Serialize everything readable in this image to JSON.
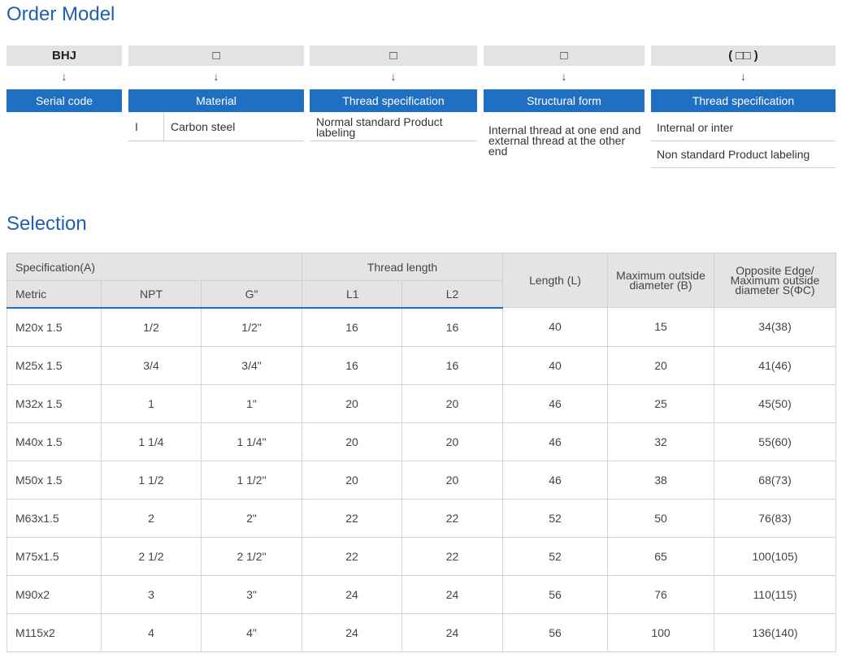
{
  "order": {
    "title": "Order Model",
    "codes": [
      "BHJ",
      "□",
      "□",
      "□",
      "( □□ )"
    ],
    "arrow": "↓",
    "labels": [
      "Serial code",
      "Material",
      "Thread specification",
      "Structural form",
      "Thread specification"
    ],
    "material": {
      "code": "I",
      "name": "Carbon steel"
    },
    "thread_spec": "Normal standard Product labeling",
    "structural": "Internal thread at one end and external thread at the other end",
    "thread_spec2": [
      "Internal or inter",
      "Non standard Product labeling"
    ]
  },
  "selection": {
    "title": "Selection",
    "headers": {
      "spec": "Specification(A)",
      "thread_length": "Thread length",
      "length": "Length (L)",
      "max_od": "Maximum outside diameter (B)",
      "opposite": "Opposite Edge/ Maximum outside diameter S(ΦC)",
      "metric": "Metric",
      "npt": "NPT",
      "g": "G\"",
      "l1": "L1",
      "l2": "L2"
    },
    "rows": [
      [
        "M20x 1.5",
        "1/2",
        "1/2\"",
        "16",
        "16",
        "40",
        "15",
        "34(38)"
      ],
      [
        "M25x 1.5",
        "3/4",
        "3/4\"",
        "16",
        "16",
        "40",
        "20",
        "41(46)"
      ],
      [
        "M32x 1.5",
        "1",
        "1\"",
        "20",
        "20",
        "46",
        "25",
        "45(50)"
      ],
      [
        "M40x 1.5",
        "1 1/4",
        "1 1/4\"",
        "20",
        "20",
        "46",
        "32",
        "55(60)"
      ],
      [
        "M50x 1.5",
        "1 1/2",
        "1 1/2\"",
        "20",
        "20",
        "46",
        "38",
        "68(73)"
      ],
      [
        "M63x1.5",
        "2",
        "2\"",
        "22",
        "22",
        "52",
        "50",
        "76(83)"
      ],
      [
        "M75x1.5",
        "2 1/2",
        "2 1/2\"",
        "22",
        "22",
        "52",
        "65",
        "100(105)"
      ],
      [
        "M90x2",
        "3",
        "3\"",
        "24",
        "24",
        "56",
        "76",
        "110(115)"
      ],
      [
        "M115x2",
        "4",
        "4\"",
        "24",
        "24",
        "56",
        "100",
        "136(140)"
      ]
    ]
  }
}
